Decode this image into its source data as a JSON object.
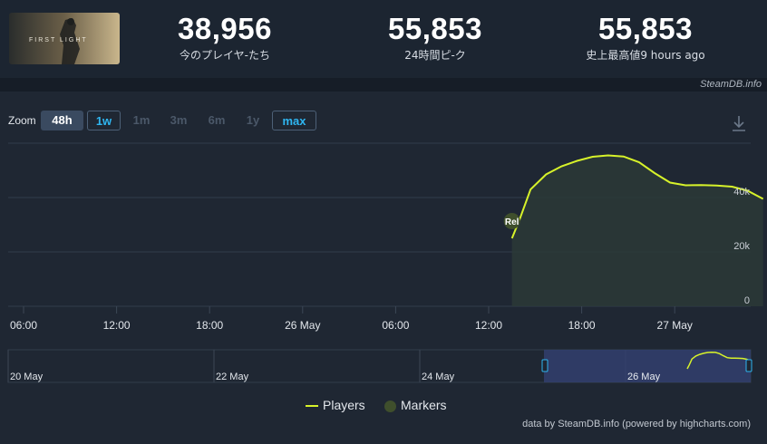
{
  "stats": [
    {
      "value": "38,956",
      "label": "今のプレイヤ-たち"
    },
    {
      "value": "55,853",
      "label": "24時間ピ-ク"
    },
    {
      "value": "55,853",
      "label": "史上最高値9 hours ago"
    }
  ],
  "thumbnail": {
    "title": "FIRST LIGHT"
  },
  "brand": "SteamDB.info",
  "zoom": {
    "label": "Zoom",
    "buttons": [
      "48h",
      "1w",
      "1m",
      "3m",
      "6m",
      "1y",
      "max"
    ],
    "selected": "48h"
  },
  "download_icon": "download-icon",
  "colors": {
    "players": "#d7f22a",
    "markers": "#3f4f2c"
  },
  "chart_data": {
    "type": "line",
    "x_ticks": [
      "06:00",
      "12:00",
      "18:00",
      "26 May",
      "06:00",
      "12:00",
      "18:00",
      "27 May"
    ],
    "y_ticks": [
      "0",
      "20k",
      "40k"
    ],
    "ylim": [
      0,
      60000
    ],
    "grid": true,
    "legend": "bottom-center",
    "series": [
      {
        "name": "Players",
        "x_hours": [
          37.5,
          38.0,
          38.7,
          39.7,
          40.7,
          41.7,
          42.7,
          43.7,
          44.7,
          45.7,
          46.7,
          47.7,
          48.7,
          49.7,
          50.7,
          51.7,
          52.7,
          53.7
        ],
        "values": [
          25000,
          32000,
          43000,
          48500,
          51500,
          53500,
          55000,
          55500,
          55100,
          53000,
          49000,
          45500,
          44500,
          44600,
          44400,
          44000,
          42500,
          39500
        ]
      }
    ],
    "markers": [
      {
        "label": "Rel",
        "x_hours": 37.5
      }
    ],
    "navigator": {
      "labels": [
        "20 May",
        "22 May",
        "24 May",
        "26 May"
      ]
    }
  },
  "legend": {
    "players": "Players",
    "markers": "Markers"
  },
  "credit": "data by SteamDB.info (powered by highcharts.com)"
}
